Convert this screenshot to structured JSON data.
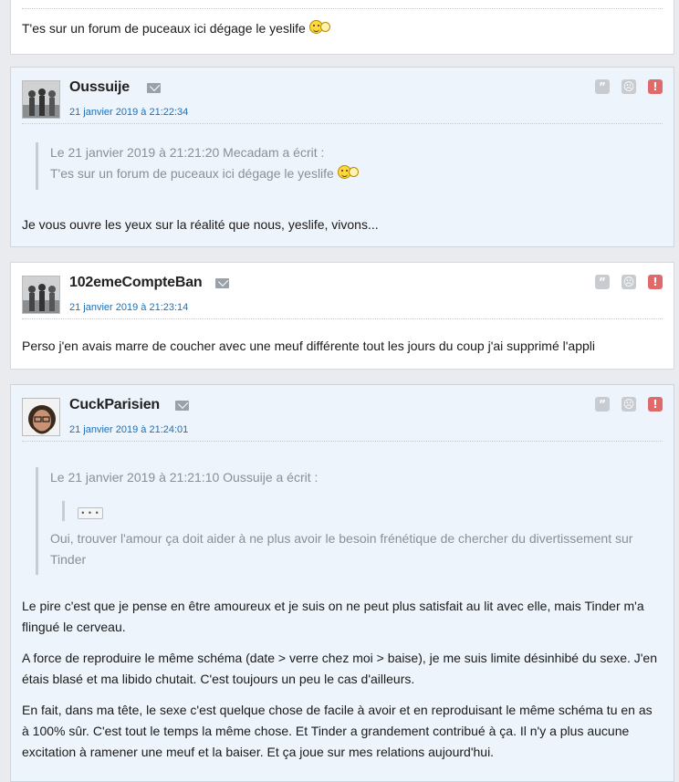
{
  "post0": {
    "text": "T'es sur un forum de puceaux ici dégage le yeslife",
    "smiley": "happy-smiley-icon"
  },
  "post1": {
    "author": "Oussuije",
    "date": "21 janvier 2019 à 21:22:34",
    "quote_header": "Le 21 janvier 2019 à 21:21:20 Mecadam a écrit :",
    "quote_text": "T'es sur un forum de puceaux ici dégage le yeslife",
    "text": "Je vous ouvre les yeux sur la réalité que nous, yeslife, vivons..."
  },
  "post2": {
    "author": "102emeCompteBan",
    "date": "21 janvier 2019 à 21:23:14",
    "text": "Perso j'en avais marre de coucher avec une meuf différente tout les jours du coup j'ai supprimé l'appli"
  },
  "post3": {
    "author": "CuckParisien",
    "date": "21 janvier 2019 à 21:24:01",
    "quote_header": "Le 21 janvier 2019 à 21:21:10 Oussuije a écrit :",
    "nested_quote_button": "• • •",
    "quote_text": "Oui, trouver l'amour ça doit aider à ne plus avoir le besoin frénétique de chercher du divertissement sur Tinder",
    "paragraphs": [
      "Le pire c'est que je pense en être amoureux et je suis on ne peut plus satisfait au lit avec elle, mais Tinder m'a flingué le cerveau.",
      "A force de reproduire le même schéma (date > verre chez moi > baise), je me suis limite désinhibé du sexe. J'en étais blasé et ma libido chutait. C'est toujours un peu le cas d'ailleurs.",
      "En fait, dans ma tête, le sexe c'est quelque chose de facile à avoir et en reproduisant le même schéma tu en as à 100% sûr. C'est tout le temps la même chose. Et Tinder a grandement contribué à ça. Il n'y a plus aucune excitation à ramener une meuf et la baiser. Et ça joue sur mes relations aujourd'hui."
    ]
  },
  "actions": {
    "quote_icon": "”",
    "report_smiley_icon": "☹",
    "alert_icon": "!"
  },
  "colors": {
    "link_blue": "#1c6fb8",
    "alert_red": "#e06a6a",
    "alt_post_bg": "#eef4fb"
  }
}
